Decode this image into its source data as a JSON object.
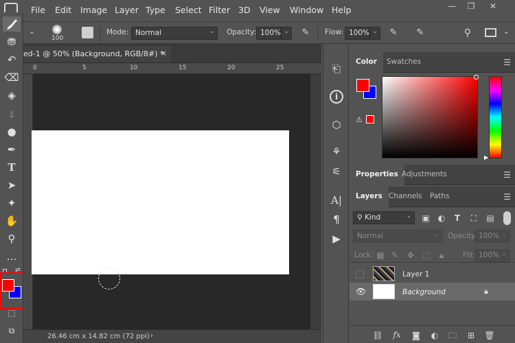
{
  "menubar": {
    "items": [
      "File",
      "Edit",
      "Image",
      "Layer",
      "Type",
      "Select",
      "Filter",
      "3D",
      "View",
      "Window",
      "Help"
    ],
    "window_controls": [
      "—",
      "❐",
      "✕"
    ]
  },
  "options": {
    "brush_size": "100",
    "mode_label": "Mode:",
    "mode_value": "Normal",
    "opacity_label": "Opacity:",
    "opacity_value": "100%",
    "flow_label": "Flow:",
    "flow_value": "100%"
  },
  "document": {
    "tab_title": "ed-1 @ 50% (Background, RGB/8#) *",
    "tab_close": "×",
    "ruler_marks": [
      "0",
      "5",
      "10",
      "15",
      "20",
      "25"
    ],
    "status": "26.46 cm x 14.82 cm (72 ppi)",
    "status_arrow": "›"
  },
  "colors": {
    "foreground": "#ff0000",
    "background": "#0000ff",
    "highlight_box": "#ff0000",
    "dock_bg": "#535353"
  },
  "color_panel": {
    "tabs": [
      "Color",
      "Swatches"
    ],
    "active_tab": "Color",
    "warning": "⚠"
  },
  "properties_panel": {
    "tabs": [
      "Properties",
      "Adjustments"
    ]
  },
  "layers_panel": {
    "tabs": [
      "Layers",
      "Channels",
      "Paths"
    ],
    "kind_label": "Kind",
    "blend_mode": "Normal",
    "opacity_label": "Opacity:",
    "opacity_value": "100%",
    "lock_label": "Lock:",
    "fill_label": "Fill:",
    "fill_value": "100%",
    "layers": [
      {
        "name": "Layer 1",
        "visible": false
      },
      {
        "name": "Background",
        "visible": true
      }
    ]
  }
}
